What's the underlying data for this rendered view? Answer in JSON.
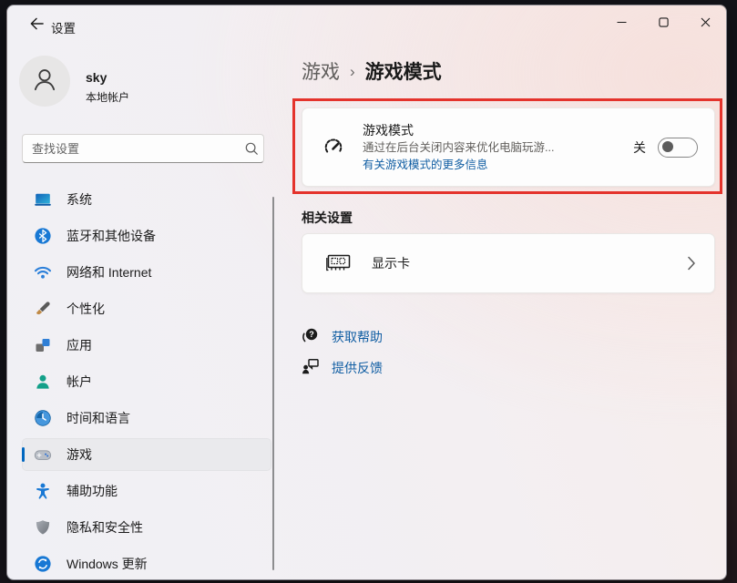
{
  "window": {
    "title": "设置"
  },
  "colors": {
    "accent": "#0067c0",
    "link": "#115ea3",
    "annotation_red": "#e4332c",
    "selected_bg": "#eaeaed"
  },
  "sidebar": {
    "user": {
      "name": "sky",
      "account_type": "本地帐户"
    },
    "search": {
      "placeholder": "查找设置"
    },
    "items": [
      {
        "label": "系统",
        "icon": "laptop-icon",
        "selected": false
      },
      {
        "label": "蓝牙和其他设备",
        "icon": "bluetooth-icon",
        "selected": false
      },
      {
        "label": "网络和 Internet",
        "icon": "wifi-icon",
        "selected": false
      },
      {
        "label": "个性化",
        "icon": "paintbrush-icon",
        "selected": false
      },
      {
        "label": "应用",
        "icon": "apps-grid-icon",
        "selected": false
      },
      {
        "label": "帐户",
        "icon": "person-icon",
        "selected": false
      },
      {
        "label": "时间和语言",
        "icon": "clock-icon",
        "selected": false
      },
      {
        "label": "游戏",
        "icon": "gamepad-icon",
        "selected": true
      },
      {
        "label": "辅助功能",
        "icon": "accessibility-person-icon",
        "selected": false
      },
      {
        "label": "隐私和安全性",
        "icon": "shield-icon",
        "selected": false
      },
      {
        "label": "Windows 更新",
        "icon": "sync-icon",
        "selected": false
      }
    ]
  },
  "main": {
    "breadcrumb": {
      "parent": "游戏",
      "separator": "›",
      "current": "游戏模式"
    },
    "game_mode": {
      "title": "游戏模式",
      "description": "通过在后台关闭内容来优化电脑玩游...",
      "link": "有关游戏模式的更多信息",
      "toggle_label": "关",
      "toggle_state": "off"
    },
    "related": {
      "header": "相关设置",
      "items": [
        {
          "label": "显示卡"
        }
      ]
    },
    "help": {
      "links": [
        {
          "label": "获取帮助"
        },
        {
          "label": "提供反馈"
        }
      ]
    }
  }
}
